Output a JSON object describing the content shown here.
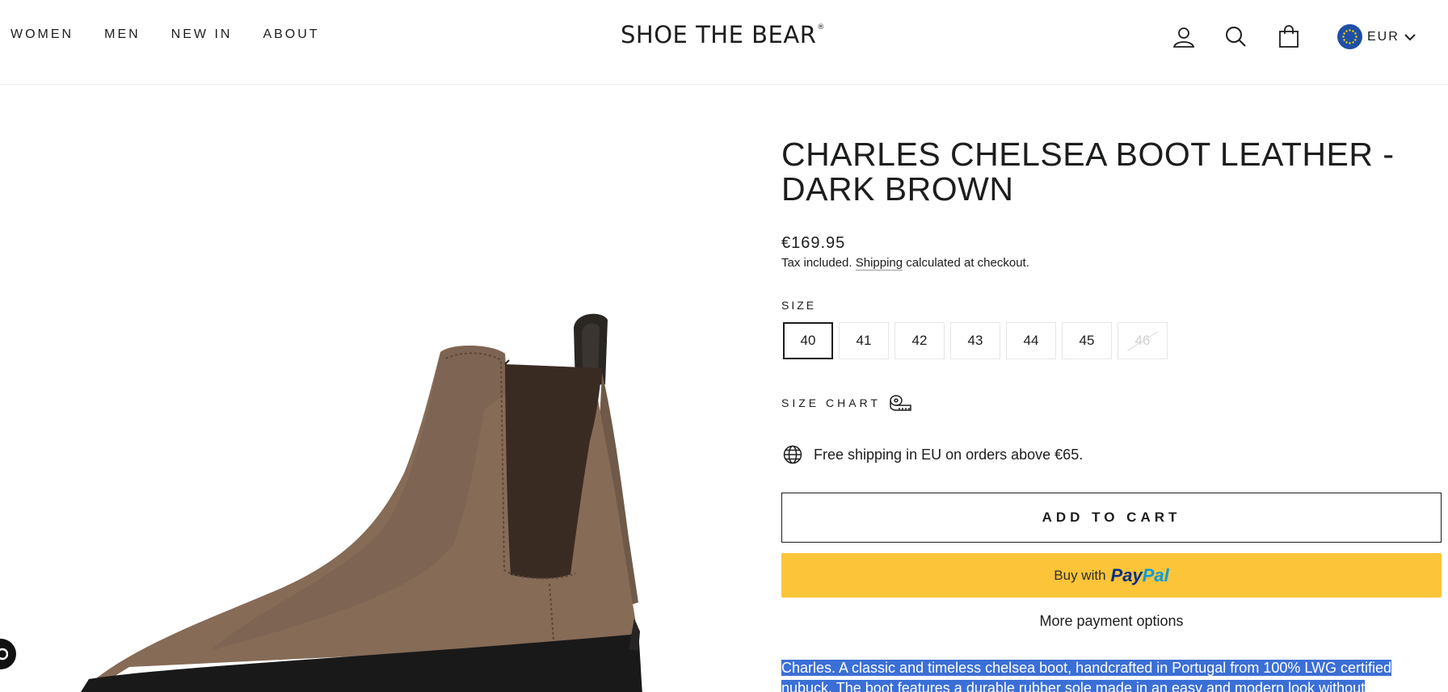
{
  "header": {
    "nav": [
      "WOMEN",
      "MEN",
      "NEW IN",
      "ABOUT"
    ],
    "logo": "SHOE THE BEAR",
    "logo_mark": "®",
    "icons": [
      "account-icon",
      "search-icon",
      "cart-icon"
    ],
    "currency": "EUR"
  },
  "product": {
    "title": "CHARLES CHELSEA BOOT LEATHER - DARK BROWN",
    "price": "€169.95",
    "tax_prefix": "Tax included.",
    "tax_link": "Shipping",
    "tax_suffix": "calculated at checkout.",
    "size_label": "SIZE",
    "sizes": [
      "40",
      "41",
      "42",
      "43",
      "44",
      "45",
      "46"
    ],
    "selected_size": "40",
    "unavailable_sizes": [
      "46"
    ],
    "size_chart_label": "SIZE CHART",
    "shipping_note": "Free shipping in EU on orders above €65.",
    "add_to_cart": "ADD TO CART",
    "paypal_prefix": "Buy with",
    "paypal_brand_1": "Pay",
    "paypal_brand_2": "Pal",
    "more_payment": "More payment options",
    "description": "Charles. A classic and timeless chelsea boot, handcrafted in Portugal from 100% LWG certified nubuck. The boot features a durable rubber sole made in an easy and modern look without"
  },
  "colors": {
    "text": "#1c1d1d",
    "paypal_yellow": "#fcc439",
    "selection_blue": "#3b6fd6",
    "flag_blue": "#1f4fa6"
  }
}
